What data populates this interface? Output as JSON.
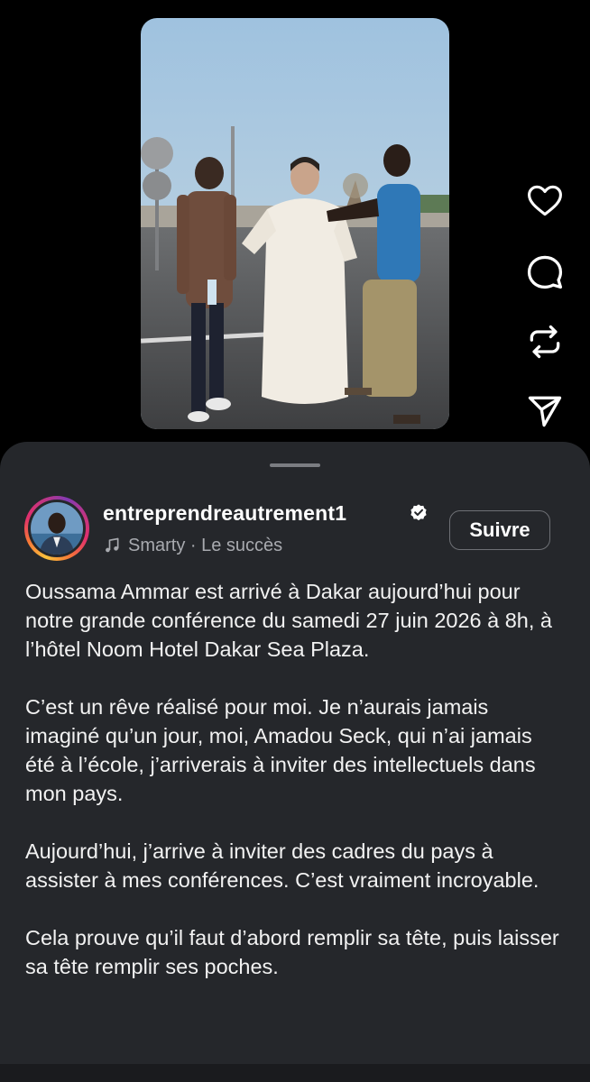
{
  "post": {
    "username": "entreprendreautrement1",
    "verified": true,
    "music_artist": "Smarty",
    "music_separator": " · ",
    "music_title": "Le succès",
    "follow_label": "Suivre",
    "caption_paragraphs": [
      "Oussama Ammar est arrivé à Dakar aujourd’hui pour notre grande conférence du samedi 27 juin 2026 à 8h, à l’hôtel Noom Hotel Dakar Sea Plaza.",
      "C’est un rêve réalisé pour moi. Je n’aurais jamais imaginé qu’un jour, moi, Amadou Seck, qui n’ai jamais été à l’école, j’arriverais à inviter des intellectuels dans mon pays.",
      "Aujourd’hui, j’arrive à inviter des cadres du pays à assister à mes conférences. C’est vraiment incroyable.",
      "Cela prouve qu’il faut d’abord remplir sa tête, puis laisser sa tête remplir ses poches."
    ]
  },
  "actions": {
    "like": "heart-icon",
    "comment": "comment-bubble-icon",
    "repost": "repost-icon",
    "share": "send-icon"
  },
  "colors": {
    "background": "#000000",
    "sheet": "#25272b",
    "muted_text": "#a8aaaf",
    "verified_badge": "#ffffff"
  }
}
